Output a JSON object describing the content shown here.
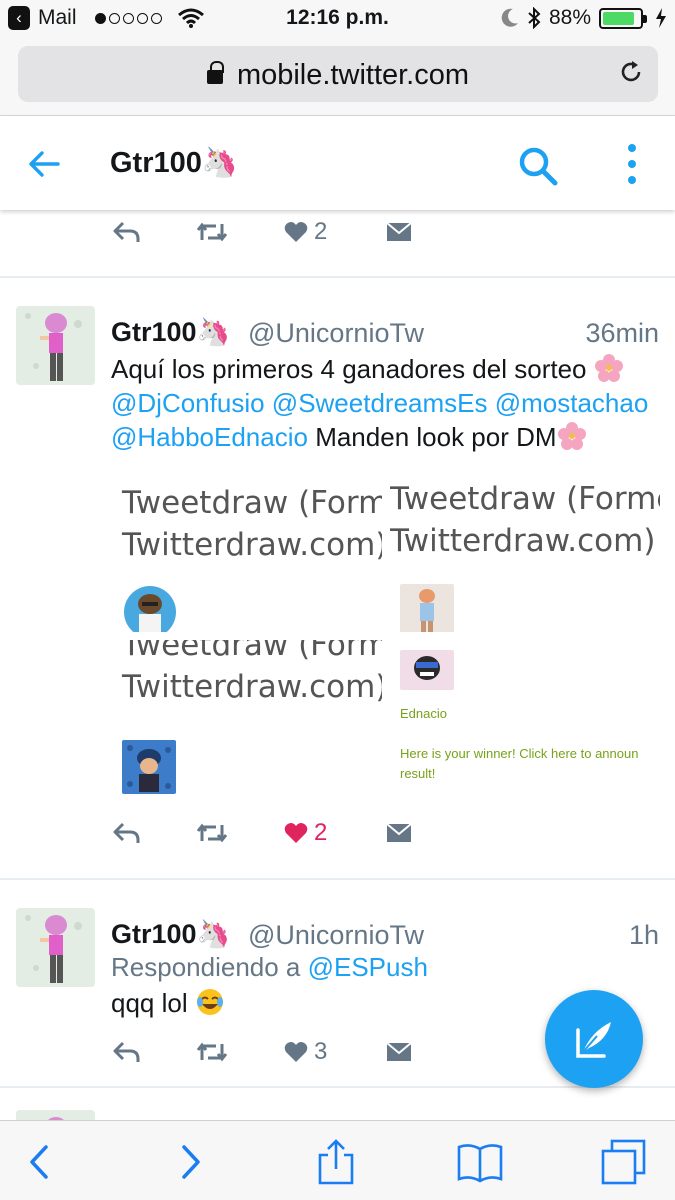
{
  "status_bar": {
    "back_app": "Mail",
    "time": "12:16 p.m.",
    "battery": "88%",
    "battery_level": 0.88
  },
  "url_bar": {
    "url": "mobile.twitter.com"
  },
  "header": {
    "title": "Gtr100🦄",
    "back_icon": "arrow-left-icon",
    "search_icon": "search-icon",
    "more_icon": "more-vertical-icon"
  },
  "prev_tweet_actions": {
    "like_count": "2"
  },
  "tweets": [
    {
      "name": "Gtr100🦄",
      "handle": "@UnicornioTw",
      "time": "36min",
      "text_start": "Aquí los primeros 4 ganadores del sorteo ",
      "mentions": [
        "@DjConfusio",
        "@SweetdreamsEs",
        "@mostachao",
        "@HabboEdnacio"
      ],
      "text_end": " Manden look por DM",
      "media": {
        "card_title_1a": "Tweetdraw (Forme",
        "card_title_1b": "Twitterdraw.com)",
        "card_title_2a": "Tweetdraw (Forme",
        "card_title_2b": "Twitterdraw.com)",
        "card_title_3a": "Tweetdraw (Forme",
        "card_title_3b": "Twitterdraw.com)",
        "winner_name": "Ednacio",
        "winner_link": "Here is your winner! Click here to announ",
        "winner_link_2": "result!"
      },
      "like_count": "2",
      "liked": true
    },
    {
      "name": "Gtr100🦄",
      "handle": "@UnicornioTw",
      "time": "1h",
      "reply_prefix": "Respondiendo a ",
      "reply_to": "@ESPush",
      "text": "qqq lol",
      "like_count": "3",
      "liked": false
    }
  ],
  "colors": {
    "twitter_blue": "#1da1f2",
    "like_red": "#e0245e",
    "gray": "#657786"
  }
}
